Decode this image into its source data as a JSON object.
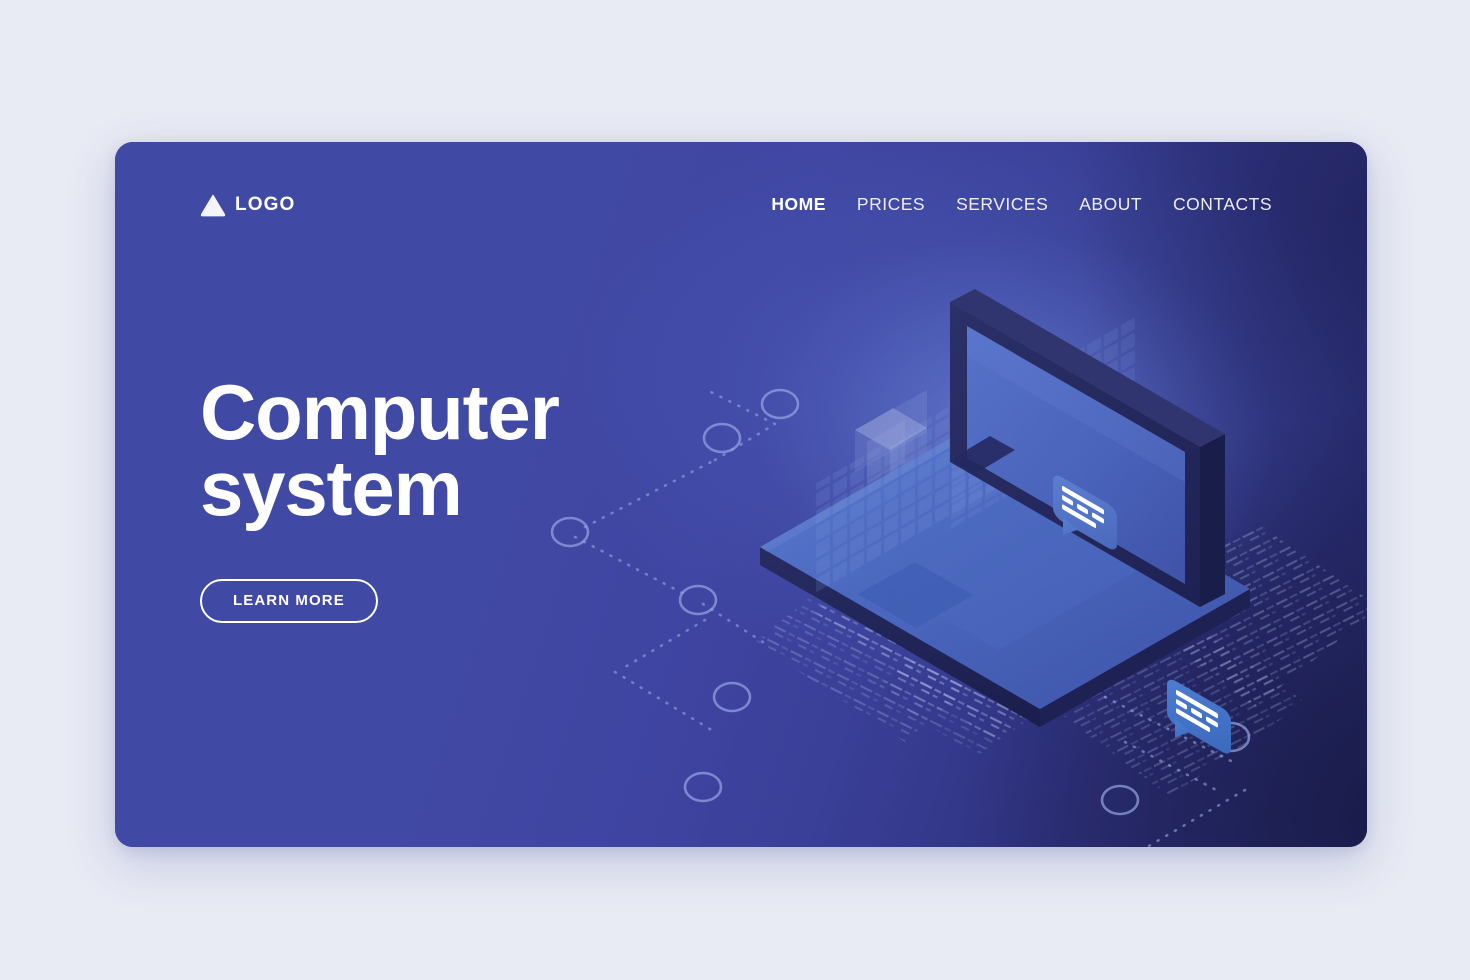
{
  "page": {
    "background_color": "#e8eaf4",
    "card_color": "#4049a4",
    "card_accent_dark": "#262a6e"
  },
  "header": {
    "logo": {
      "icon": "triangle-icon",
      "text": "LOGO"
    },
    "nav": [
      {
        "label": "HOME",
        "active": true
      },
      {
        "label": "PRICES",
        "active": false
      },
      {
        "label": "SERVICES",
        "active": false
      },
      {
        "label": "ABOUT",
        "active": false
      },
      {
        "label": "CONTACTS",
        "active": false
      }
    ]
  },
  "hero": {
    "title_line_1": "Computer",
    "title_line_2": "system",
    "cta_label": "LEARN MORE",
    "illustration": {
      "name": "isometric-laptop-illustration",
      "laptop_screen_color": "#4f68bd",
      "laptop_bezel_color": "#232murky",
      "chat_bubble_color": "#3d6fc4",
      "code_rain_color": "#b9c6ee",
      "node_circle_color": "#8c9ade",
      "bubbles": 2,
      "network_nodes": 8
    }
  }
}
